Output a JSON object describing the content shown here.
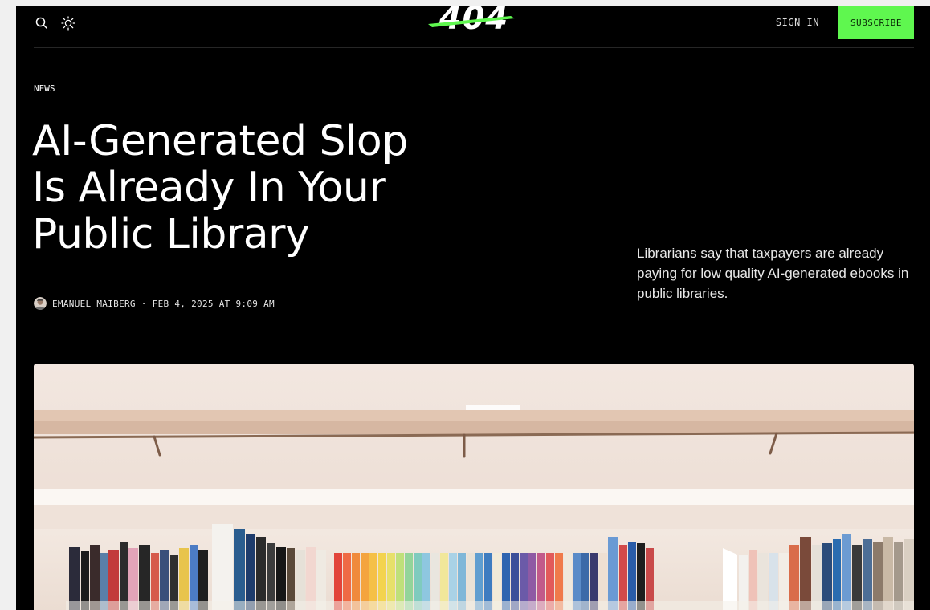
{
  "header": {
    "logo": "404",
    "sign_in": "SIGN IN",
    "subscribe": "SUBSCRIBE",
    "icons": [
      "search-icon",
      "sun-icon"
    ]
  },
  "article": {
    "category": "NEWS",
    "title_lines": [
      "AI-Generated Slop",
      "Is Already In Your",
      "Public Library"
    ],
    "author": "EMANUEL MAIBERG",
    "separator": "·",
    "date": "FEB 4, 2025 AT 9:09 AM",
    "excerpt": "Librarians say that taxpayers are already paying for low quality AI-generated ebooks in public libraries."
  },
  "colors": {
    "background": "#000000",
    "accent": "#5ff74f",
    "text": "#ffffff"
  }
}
